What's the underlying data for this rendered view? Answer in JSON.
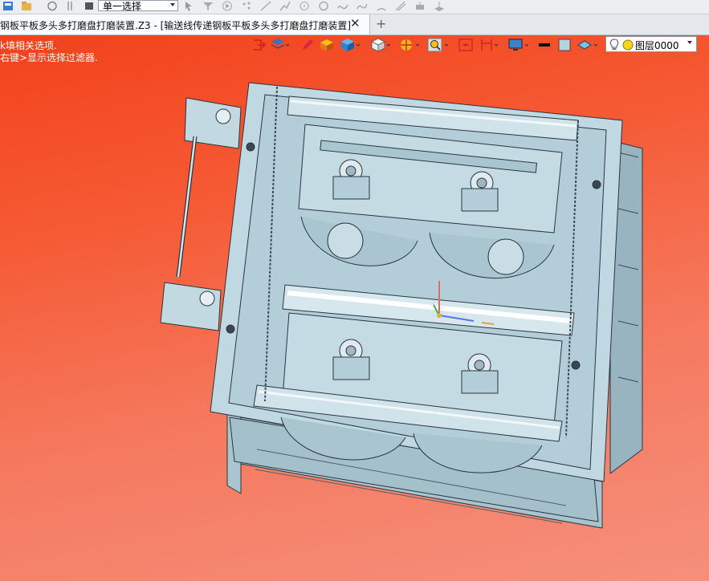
{
  "toolbar": {
    "selection_mode": "单一选择"
  },
  "tabs": {
    "active_label": "钢板平板多头多打磨盘打磨装置.Z3 - [输送线传递钢板平板多头多打磨盘打磨装置]",
    "close_glyph": "✕",
    "add_glyph": "+"
  },
  "viewport": {
    "hint_line1": "k填相关选项.",
    "hint_line2": "右键>显示选择过滤器."
  },
  "view_toolbar": {
    "layer_label": "图层0000"
  },
  "colors": {
    "bg_top": "#f2421c",
    "bg_bottom": "#f58f7c",
    "model_fill": "#b9d3dd",
    "model_edge": "#2a3540"
  }
}
